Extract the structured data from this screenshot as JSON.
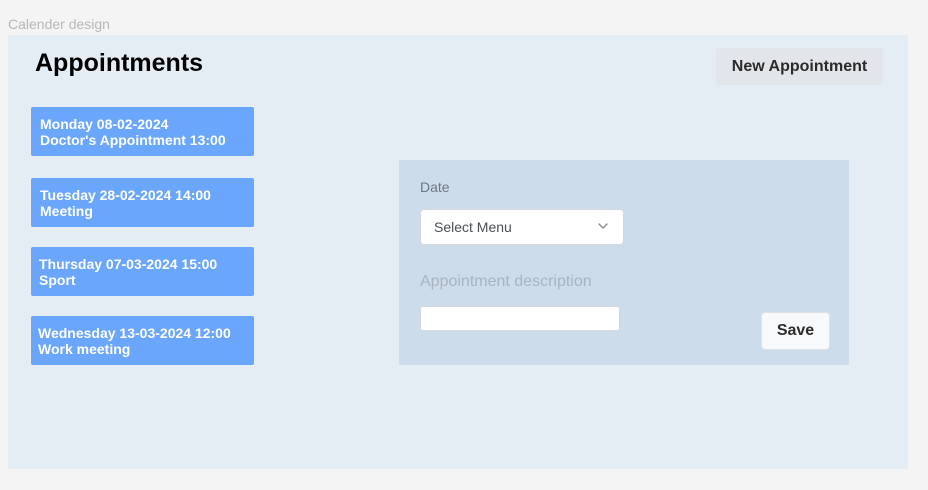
{
  "canvas": {
    "frame_label": "Calender design"
  },
  "header": {
    "title": "Appointments",
    "new_button_label": "New Appointment"
  },
  "appointments": [
    {
      "line1": "Monday 08-02-2024",
      "line2": "Doctor's Appointment 13:00"
    },
    {
      "line1": "Tuesday 28-02-2024 14:00",
      "line2": "Meeting"
    },
    {
      "line1": "Thursday 07-03-2024 15:00",
      "line2": "Sport"
    },
    {
      "line1": "Wednesday 13-03-2024 12:00",
      "line2": "Work meeting"
    }
  ],
  "form": {
    "date_label": "Date",
    "select_value": "Select Menu",
    "description_label": "Appointment description",
    "description_value": "",
    "save_label": "Save"
  },
  "colors": {
    "frame_background": "#e4edf4",
    "card_background": "#69a6fc",
    "panel_background": "#cddceb"
  }
}
